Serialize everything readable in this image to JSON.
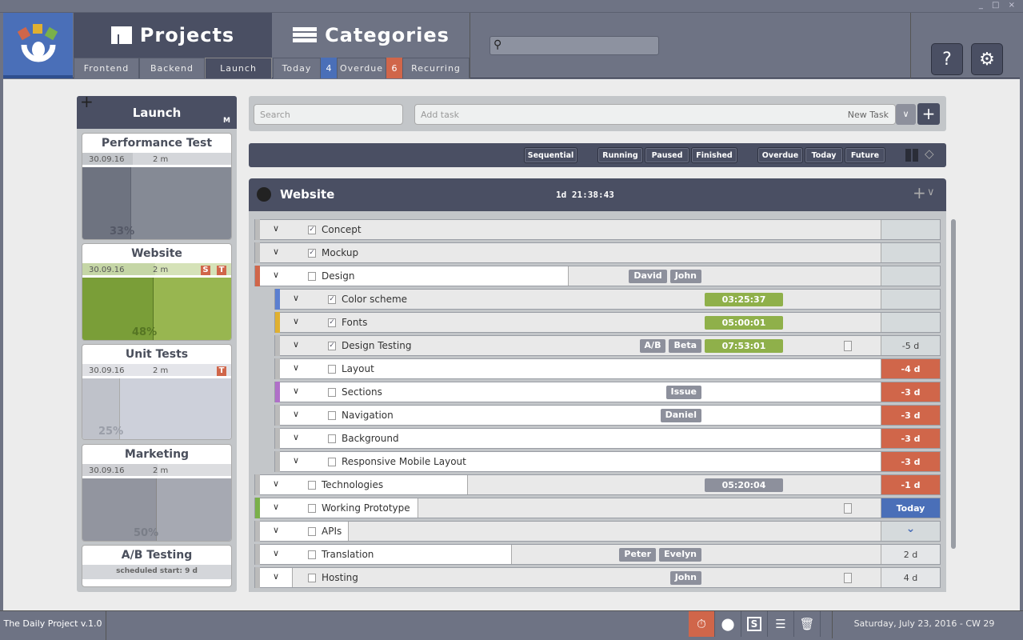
{
  "window_controls": "_ □ ×",
  "nav": {
    "projects_label": "Projects",
    "categories_label": "Categories",
    "project_tabs": [
      "Frontend",
      "Backend",
      "Launch"
    ],
    "category_tabs": [
      {
        "label": "Today",
        "count": "4",
        "color": "#4a6fb8"
      },
      {
        "label": "Overdue",
        "count": "6",
        "color": "#d0664a"
      },
      {
        "label": "Recurring"
      }
    ],
    "help": "?"
  },
  "sidebar": {
    "title": "Launch",
    "add": "+",
    "m_badge": "M",
    "cards": [
      {
        "name": "Performance Test",
        "date": "30.09.16",
        "duration": "2 m",
        "progress_pct": "33%",
        "progress": 0.33,
        "badges": []
      },
      {
        "name": "Website",
        "date": "30.09.16",
        "duration": "2 m",
        "progress_pct": "48%",
        "progress": 0.48,
        "badges": [
          "S",
          "T"
        ]
      },
      {
        "name": "Unit Tests",
        "date": "30.09.16",
        "duration": "2 m",
        "progress_pct": "25%",
        "progress": 0.25,
        "badges": [
          "T"
        ]
      },
      {
        "name": "Marketing",
        "date": "30.09.16",
        "duration": "2 m",
        "progress_pct": "50%",
        "progress": 0.5,
        "badges": []
      },
      {
        "name": "A/B Testing",
        "scheduled": "scheduled start: 9 d"
      }
    ]
  },
  "toolbar": {
    "search_placeholder": "Search",
    "add_placeholder": "Add task",
    "new_task": "New Task"
  },
  "filters": [
    "Sequential",
    "Running",
    "Paused",
    "Finished",
    "Overdue",
    "Today",
    "Future"
  ],
  "project": {
    "name": "Website",
    "elapsed": "1d 21:38:43"
  },
  "tasks": [
    {
      "name": "Concept",
      "done": true,
      "level": 0,
      "progress": 0
    },
    {
      "name": "Mockup",
      "done": true,
      "level": 0,
      "progress": 0
    },
    {
      "name": "Design",
      "done": false,
      "level": 0,
      "color": "#d0664a",
      "progress": 0.5,
      "tags": [
        "David",
        "John"
      ]
    },
    {
      "name": "Color scheme",
      "done": true,
      "level": 1,
      "color": "#5b7fd0",
      "progress": 0,
      "timer": "03:25:37"
    },
    {
      "name": "Fonts",
      "done": true,
      "level": 1,
      "color": "#e0b030",
      "progress": 0,
      "timer": "05:00:01"
    },
    {
      "name": "Design Testing",
      "done": true,
      "level": 1,
      "progress": 0,
      "tags": [
        "A/B",
        "Beta"
      ],
      "timer": "07:53:01",
      "note": true,
      "due": "-5 d"
    },
    {
      "name": "Layout",
      "done": false,
      "level": 1,
      "progress": 1,
      "due": "-4 d",
      "due_type": "over"
    },
    {
      "name": "Sections",
      "done": false,
      "level": 1,
      "color": "#b070c8",
      "progress": 1,
      "tags": [
        "Issue"
      ],
      "due": "-3 d",
      "due_type": "over"
    },
    {
      "name": "Navigation",
      "done": false,
      "level": 1,
      "progress": 1,
      "tags": [
        "Daniel"
      ],
      "due": "-3 d",
      "due_type": "over"
    },
    {
      "name": "Background",
      "done": false,
      "level": 1,
      "progress": 1,
      "due": "-3 d",
      "due_type": "over"
    },
    {
      "name": "Responsive Mobile Layout",
      "done": false,
      "level": 1,
      "progress": 1,
      "due": "-3 d",
      "due_type": "over"
    },
    {
      "name": "Technologies",
      "done": false,
      "level": 0,
      "progress": 0.34,
      "timer": "05:20:04",
      "timer_idle": true,
      "due": "-1 d",
      "due_type": "over"
    },
    {
      "name": "Working Prototype",
      "done": false,
      "level": 0,
      "color": "#7ab04a",
      "progress": 0.26,
      "note": true,
      "due": "Today",
      "due_type": "today"
    },
    {
      "name": "APIs",
      "done": false,
      "level": 0,
      "progress": 0.15,
      "due": "⌄",
      "due_type": "chevron"
    },
    {
      "name": "Translation",
      "done": false,
      "level": 0,
      "progress": 0.41,
      "tags": [
        "Peter",
        "Evelyn"
      ],
      "due": "2 d",
      "due_type": "light"
    },
    {
      "name": "Hosting",
      "done": false,
      "level": 0,
      "progress": 0.06,
      "tags": [
        "John"
      ],
      "note": true,
      "due": "4 d",
      "due_type": "light"
    }
  ],
  "status": {
    "version": "The Daily Project v.1.0",
    "date": "Saturday, July 23, 2016 - CW 29"
  }
}
